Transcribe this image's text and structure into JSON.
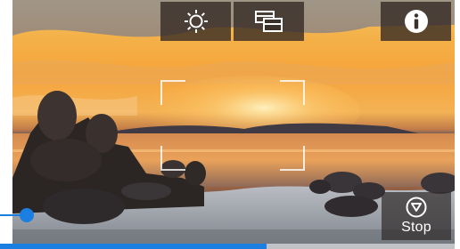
{
  "controls": {
    "brightness": {
      "icon": "brightness-icon"
    },
    "display_mode": {
      "icon": "display-mode-icon"
    },
    "info": {
      "icon": "info-icon"
    },
    "stop": {
      "label": "Stop",
      "icon": "stop-icon"
    }
  },
  "recording_progress": 0.58,
  "zoom_level": 0.05,
  "colors": {
    "accent": "#1a7fe0",
    "button_bg": "#32281f",
    "icon": "#ffffff"
  }
}
